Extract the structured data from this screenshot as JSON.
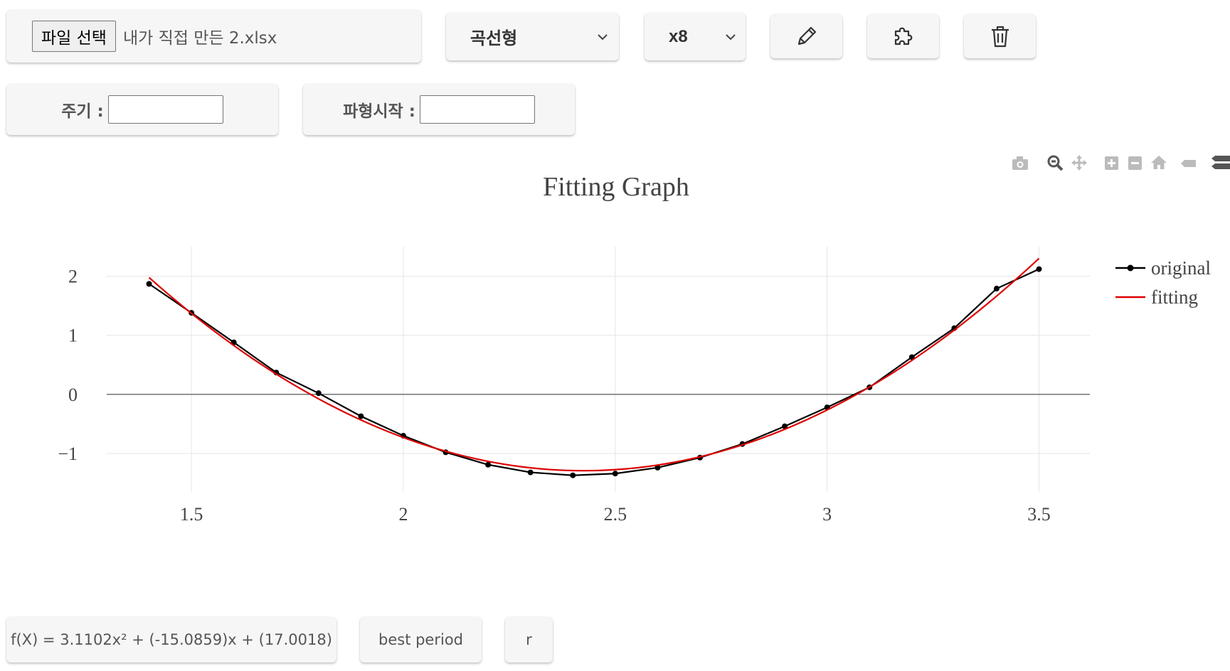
{
  "toolbar": {
    "file_button_label": "파일 선택",
    "file_name": "내가 직접 만든 2.xlsx",
    "fit_type": "곡선형",
    "multiplier": "x8",
    "edit_icon": "pencil-icon",
    "plugin_icon": "puzzle-icon",
    "delete_icon": "trash-icon"
  },
  "fields": {
    "period_label": "주기 :",
    "period_value": "",
    "wave_start_label": "파형시작 :",
    "wave_start_value": ""
  },
  "modebar": {
    "icons": [
      "camera-icon",
      "zoom-icon",
      "pan-icon",
      "zoom-in-icon",
      "zoom-out-icon",
      "reset-axes-icon",
      "spike-lines-icon",
      "hover-compare-icon"
    ]
  },
  "chart_data": {
    "type": "line",
    "title": "Fitting Graph",
    "xlabel": "",
    "ylabel": "",
    "xlim": [
      1.3,
      3.62
    ],
    "ylim": [
      -1.65,
      2.5
    ],
    "x_ticks": [
      1.5,
      2,
      2.5,
      3,
      3.5
    ],
    "x_tick_labels": [
      "1.5",
      "2",
      "2.5",
      "3",
      "3.5"
    ],
    "y_ticks": [
      -1,
      0,
      1,
      2
    ],
    "y_tick_labels": [
      "−1",
      "0",
      "1",
      "2"
    ],
    "grid": true,
    "legend_position": "top-right",
    "colors": {
      "original": "#000000",
      "fitting": "#dd0000"
    },
    "series": [
      {
        "name": "original",
        "mode": "lines+markers",
        "x": [
          1.4,
          1.5,
          1.6,
          1.7,
          1.8,
          1.9,
          2.0,
          2.1,
          2.2,
          2.3,
          2.4,
          2.5,
          2.6,
          2.7,
          2.8,
          2.9,
          3.0,
          3.1,
          3.2,
          3.3,
          3.4,
          3.5
        ],
        "y": [
          1.87,
          1.38,
          0.88,
          0.37,
          0.02,
          -0.37,
          -0.7,
          -0.98,
          -1.19,
          -1.32,
          -1.37,
          -1.34,
          -1.24,
          -1.07,
          -0.84,
          -0.54,
          -0.22,
          0.12,
          0.63,
          1.12,
          1.79,
          2.12
        ]
      },
      {
        "name": "fitting",
        "mode": "lines",
        "equation": {
          "a": 3.1102,
          "b": -15.0859,
          "c": 17.0018
        },
        "x_range": [
          1.4,
          3.5
        ]
      }
    ]
  },
  "results": {
    "formula": "f(X) = 3.1102x² + (-15.0859)x + (17.0018)",
    "best_period_label": "best period",
    "r_label": "r"
  }
}
